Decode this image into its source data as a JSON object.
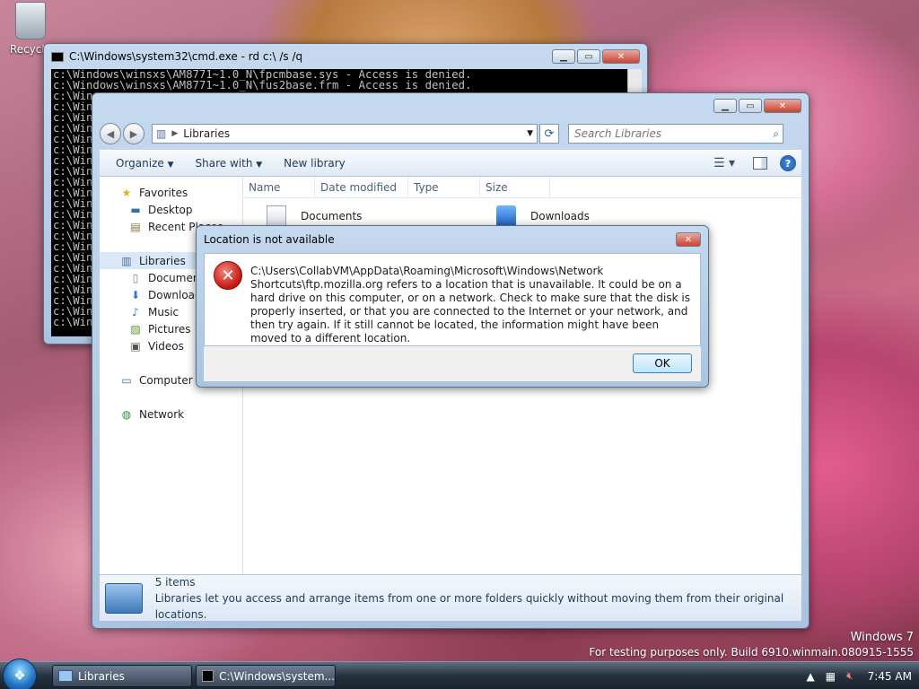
{
  "desktop": {
    "recycle_label": "Recycle"
  },
  "cmd": {
    "title": "C:\\Windows\\system32\\cmd.exe - rd  c:\\ /s /q",
    "lines": [
      "c:\\Windows\\winsxs\\AM8771~1.0_N\\fpcmbase.sys - Access is denied.",
      "c:\\Windows\\winsxs\\AM8771~1.0_N\\fus2base.frm - Access is denied.",
      "c:\\Win",
      "c:\\Win",
      "c:\\Win",
      "c:\\Win",
      "c:\\Win",
      "c:\\Win",
      "c:\\Win",
      "c:\\Win",
      "c:\\Win",
      "c:\\Win",
      "c:\\Win",
      "c:\\Win",
      "c:\\Win",
      "c:\\Win",
      "c:\\Win",
      "c:\\Win",
      "c:\\Win",
      "c:\\Win",
      "c:\\Win",
      "c:\\Win",
      "c:\\Win",
      "c:\\Win"
    ]
  },
  "explorer": {
    "address": "Libraries",
    "search_placeholder": "Search Libraries",
    "toolbar": {
      "organize": "Organize",
      "share_with": "Share with",
      "new_library": "New library"
    },
    "nav": {
      "favorites": "Favorites",
      "desktop": "Desktop",
      "recent": "Recent Places",
      "libraries": "Libraries",
      "documents": "Documents",
      "downloads": "Downloads",
      "music": "Music",
      "pictures": "Pictures",
      "videos": "Videos",
      "computer": "Computer",
      "network": "Network"
    },
    "columns": {
      "name": "Name",
      "date": "Date modified",
      "type": "Type",
      "size": "Size"
    },
    "items": [
      {
        "name": "Documents"
      },
      {
        "name": "Downloads"
      }
    ],
    "status": {
      "count": "5 items",
      "description": "Libraries let you access and arrange items from one or more folders quickly without moving them from their original locations."
    }
  },
  "dialog": {
    "title": "Location is not available",
    "message": "C:\\Users\\CollabVM\\AppData\\Roaming\\Microsoft\\Windows\\Network Shortcuts\\ftp.mozilla.org refers to a location that is unavailable. It could be on a hard drive on this computer, or on a network. Check to make sure that the disk is properly inserted, or that you are connected to the Internet or your network, and then try again. If it still cannot be located, the information might have been moved to a different location.",
    "ok": "OK"
  },
  "watermark": {
    "os": "Windows 7",
    "build": "For testing purposes only. Build 6910.winmain.080915-1555"
  },
  "taskbar": {
    "libraries": "Libraries",
    "cmd": "C:\\Windows\\system...",
    "clock": "7:45 AM"
  },
  "colors": {
    "error_red": "#c4150d",
    "accent_blue": "#1e395b"
  }
}
